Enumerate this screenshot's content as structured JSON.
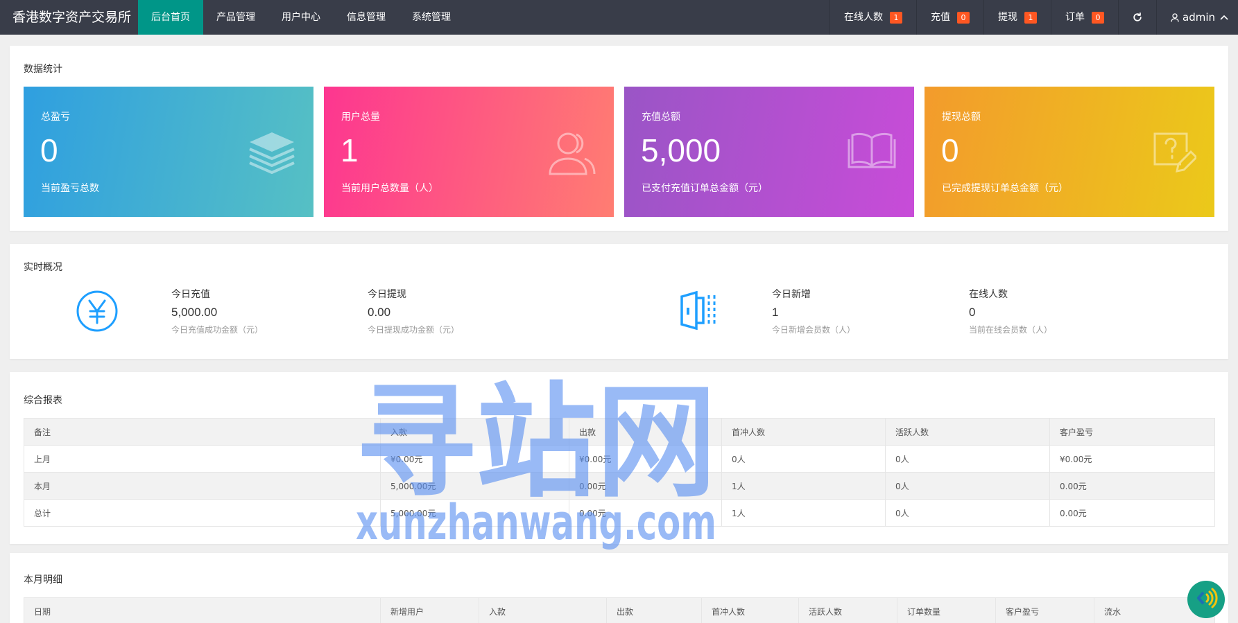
{
  "header": {
    "logo": "香港数字资产交易所",
    "nav": [
      "后台首页",
      "产品管理",
      "用户中心",
      "信息管理",
      "系统管理"
    ],
    "active_index": 0,
    "right": {
      "online_label": "在线人数",
      "online_count": "1",
      "recharge_label": "充值",
      "recharge_count": "0",
      "withdraw_label": "提现",
      "withdraw_count": "1",
      "order_label": "订单",
      "order_count": "0",
      "refresh_icon": "refresh-icon",
      "user_icon": "user-icon",
      "user_name": "admin",
      "user_chevron": "chevron-up-icon"
    }
  },
  "stats": {
    "title": "数据统计",
    "tiles": [
      {
        "label": "总盈亏",
        "value": "0",
        "desc": "当前盈亏总数",
        "icon": "layers-icon",
        "color": "#2f9fe0"
      },
      {
        "label": "用户总量",
        "value": "1",
        "desc": "当前用户总数量（人）",
        "icon": "users-icon",
        "color": "#fd3690"
      },
      {
        "label": "充值总额",
        "value": "5,000",
        "desc": "已支付充值订单总金额（元）",
        "icon": "book-icon",
        "color": "#9a55c6"
      },
      {
        "label": "提现总额",
        "value": "0",
        "desc": "已完成提现订单总金额（元）",
        "icon": "question-edit-icon",
        "color": "#f39b2c"
      }
    ]
  },
  "realtime": {
    "title": "实时概况",
    "money_icon": "yen-circle-icon",
    "member_icon": "door-icon",
    "items": [
      {
        "label": "今日充值",
        "value": "5,000.00",
        "desc": "今日充值成功金额（元）"
      },
      {
        "label": "今日提现",
        "value": "0.00",
        "desc": "今日提现成功金额（元）"
      },
      {
        "label": "今日新增",
        "value": "1",
        "desc": "今日新增会员数（人）"
      },
      {
        "label": "在线人数",
        "value": "0",
        "desc": "当前在线会员数（人）"
      }
    ]
  },
  "report": {
    "title": "综合报表",
    "columns": [
      "备注",
      "入款",
      "出款",
      "首冲人数",
      "活跃人数",
      "客户盈亏"
    ],
    "rows": [
      [
        "上月",
        "¥0.00元",
        "¥0.00元",
        "0人",
        "0人",
        "¥0.00元"
      ],
      [
        "本月",
        "5,000.00元",
        "0.00元",
        "1人",
        "0人",
        "0.00元"
      ],
      [
        "总计",
        "5,000.00元",
        "0.00元",
        "1人",
        "0人",
        "0.00元"
      ]
    ]
  },
  "monthly": {
    "title": "本月明细",
    "columns": [
      "日期",
      "新增用户",
      "入款",
      "出款",
      "首冲人数",
      "活跃人数",
      "订单数量",
      "客户盈亏",
      "流水"
    ]
  },
  "watermark": {
    "line1": "寻站网",
    "line2": "xunzhanwang.com",
    "color": "#5b8ff0"
  },
  "float_button": {
    "icon": "sound-wave-icon",
    "color": "#16a085"
  }
}
